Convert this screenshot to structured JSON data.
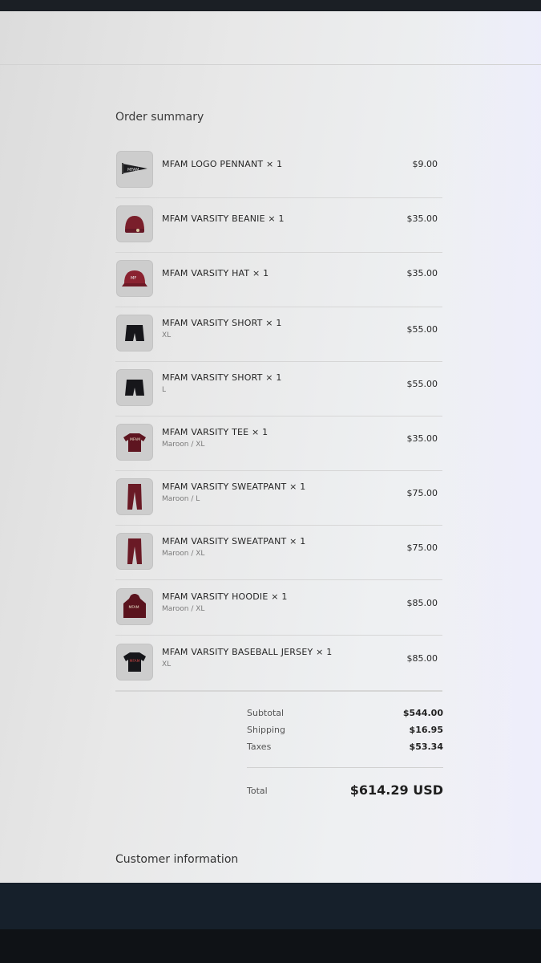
{
  "order_summary": {
    "title": "Order summary",
    "items": [
      {
        "name": "MFAM LOGO PENNANT × 1",
        "variant": "",
        "price": "$9.00",
        "icon": "pennant-icon"
      },
      {
        "name": "MFAM VARSITY BEANIE × 1",
        "variant": "",
        "price": "$35.00",
        "icon": "beanie-icon"
      },
      {
        "name": "MFAM VARSITY HAT × 1",
        "variant": "",
        "price": "$35.00",
        "icon": "hat-icon"
      },
      {
        "name": "MFAM VARSITY SHORT × 1",
        "variant": "XL",
        "price": "$55.00",
        "icon": "shorts-icon"
      },
      {
        "name": "MFAM VARSITY SHORT × 1",
        "variant": "L",
        "price": "$55.00",
        "icon": "shorts-icon"
      },
      {
        "name": "MFAM VARSITY TEE × 1",
        "variant": "Maroon / XL",
        "price": "$35.00",
        "icon": "tee-icon"
      },
      {
        "name": "MFAM VARSITY SWEATPANT × 1",
        "variant": "Maroon / L",
        "price": "$75.00",
        "icon": "sweatpant-icon"
      },
      {
        "name": "MFAM VARSITY SWEATPANT × 1",
        "variant": "Maroon / XL",
        "price": "$75.00",
        "icon": "sweatpant-icon"
      },
      {
        "name": "MFAM VARSITY HOODIE × 1",
        "variant": "Maroon / XL",
        "price": "$85.00",
        "icon": "hoodie-icon"
      },
      {
        "name": "MFAM VARSITY BASEBALL JERSEY × 1",
        "variant": "XL",
        "price": "$85.00",
        "icon": "jersey-icon"
      }
    ],
    "subtotal_label": "Subtotal",
    "subtotal": "$544.00",
    "shipping_label": "Shipping",
    "shipping": "$16.95",
    "taxes_label": "Taxes",
    "taxes": "$53.34",
    "total_label": "Total",
    "total": "$614.29 USD"
  },
  "customer_info": {
    "title": "Customer information"
  },
  "colors": {
    "maroon": "#7a1f2b",
    "black_garment": "#16161a"
  }
}
